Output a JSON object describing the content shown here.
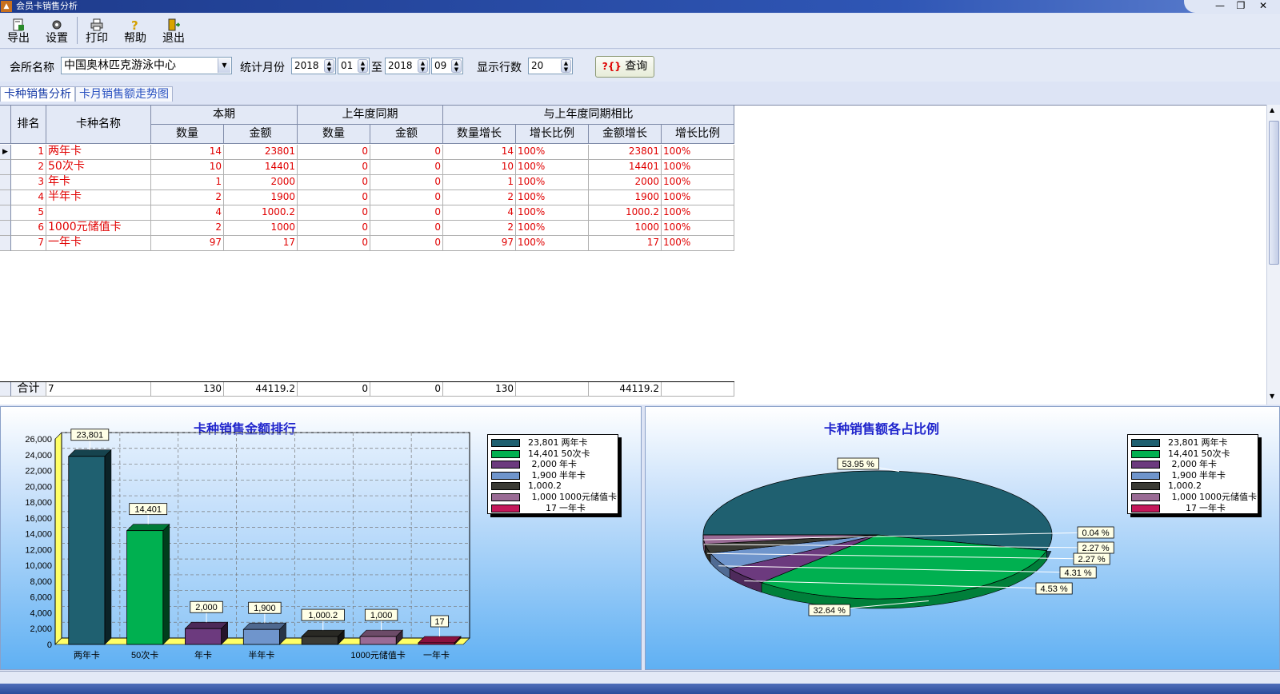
{
  "window": {
    "title": "会员卡销售分析",
    "minimize": "—",
    "restore": "❐",
    "close": "✕"
  },
  "toolbar": {
    "export": "导出",
    "settings": "设置",
    "print": "打印",
    "help": "帮助",
    "exit": "退出"
  },
  "filter": {
    "club_label": "会所名称",
    "club_value": "中国奥林匹克游泳中心",
    "month_label": "统计月份",
    "start_year": "2018",
    "start_month": "01",
    "to_label": "至",
    "end_year": "2018",
    "end_month": "09",
    "rows_label": "显示行数",
    "rows_value": "20",
    "query_label": "查询",
    "query_icon": "?{}"
  },
  "tabs": {
    "tab1": "卡种销售分析",
    "tab2": "卡月销售额走势图"
  },
  "table": {
    "h_rank": "排名",
    "h_name": "卡种名称",
    "h_cur": "本期",
    "h_prev": "上年度同期",
    "h_cmp": "与上年度同期相比",
    "h_qty": "数量",
    "h_amt": "金额",
    "h_qty2": "数量",
    "h_amt2": "金额",
    "h_qtyinc": "数量增长",
    "h_qtyratio": "增长比例",
    "h_amtinc": "金额增长",
    "h_amtratio": "增长比例",
    "rows": [
      [
        "1",
        "两年卡",
        "14",
        "23801",
        "0",
        "0",
        "14",
        "100%",
        "23801",
        "100%"
      ],
      [
        "2",
        "50次卡",
        "10",
        "14401",
        "0",
        "0",
        "10",
        "100%",
        "14401",
        "100%"
      ],
      [
        "3",
        "年卡",
        "1",
        "2000",
        "0",
        "0",
        "1",
        "100%",
        "2000",
        "100%"
      ],
      [
        "4",
        "半年卡",
        "2",
        "1900",
        "0",
        "0",
        "2",
        "100%",
        "1900",
        "100%"
      ],
      [
        "5",
        "",
        "4",
        "1000.2",
        "0",
        "0",
        "4",
        "100%",
        "1000.2",
        "100%"
      ],
      [
        "6",
        "1000元储值卡",
        "2",
        "1000",
        "0",
        "0",
        "2",
        "100%",
        "1000",
        "100%"
      ],
      [
        "7",
        "一年卡",
        "97",
        "17",
        "0",
        "0",
        "97",
        "100%",
        "17",
        "100%"
      ]
    ],
    "total": {
      "label": "合计",
      "count": "7",
      "qty": "130",
      "amt": "44119.2",
      "qty2": "0",
      "amt2": "0",
      "qtyinc": "130",
      "amtinc": "44119.2"
    }
  },
  "colors": [
    "#1f6070",
    "#00b050",
    "#6c3a7e",
    "#6f95cc",
    "#3a3a34",
    "#9a6b95",
    "#c4185a"
  ],
  "chart_data": [
    {
      "type": "bar",
      "title": "卡种销售金额排行",
      "categories": [
        "两年卡",
        "50次卡",
        "年卡",
        "半年卡",
        "",
        "1000元储值卡",
        "一年卡"
      ],
      "values": [
        23801,
        14401,
        2000,
        1900,
        1000.2,
        1000,
        17
      ],
      "data_labels": [
        "23,801",
        "14,401",
        "2,000",
        "1,900",
        "1,000.2",
        "1,000",
        "17"
      ],
      "yticks": [
        "0",
        "2,000",
        "4,000",
        "6,000",
        "8,000",
        "10,000",
        "12,000",
        "14,000",
        "16,000",
        "18,000",
        "20,000",
        "22,000",
        "24,000",
        "26,000"
      ],
      "ylim": [
        0,
        26000
      ],
      "grid": true,
      "legend": [
        {
          "value": "23,801",
          "name": "两年卡"
        },
        {
          "value": "14,401",
          "name": "50次卡"
        },
        {
          "value": "2,000",
          "name": "年卡"
        },
        {
          "value": "1,900",
          "name": "半年卡"
        },
        {
          "value": "1,000.2",
          "name": ""
        },
        {
          "value": "1,000",
          "name": "1000元储值卡"
        },
        {
          "value": "17",
          "name": "一年卡"
        }
      ],
      "legend_position": "top-right"
    },
    {
      "type": "pie",
      "title": "卡种销售额各占比例",
      "values": [
        23801,
        14401,
        2000,
        1900,
        1000.2,
        1000,
        17
      ],
      "percent_labels": [
        "53.95 %",
        "32.64 %",
        "4.53 %",
        "4.31 %",
        "2.27 %",
        "2.27 %",
        "0.04 %"
      ],
      "legend": [
        {
          "value": "23,801",
          "name": "两年卡"
        },
        {
          "value": "14,401",
          "name": "50次卡"
        },
        {
          "value": "2,000",
          "name": "年卡"
        },
        {
          "value": "1,900",
          "name": "半年卡"
        },
        {
          "value": "1,000.2",
          "name": ""
        },
        {
          "value": "1,000",
          "name": "1000元储值卡"
        },
        {
          "value": "17",
          "name": "一年卡"
        }
      ],
      "legend_position": "top-right"
    }
  ]
}
